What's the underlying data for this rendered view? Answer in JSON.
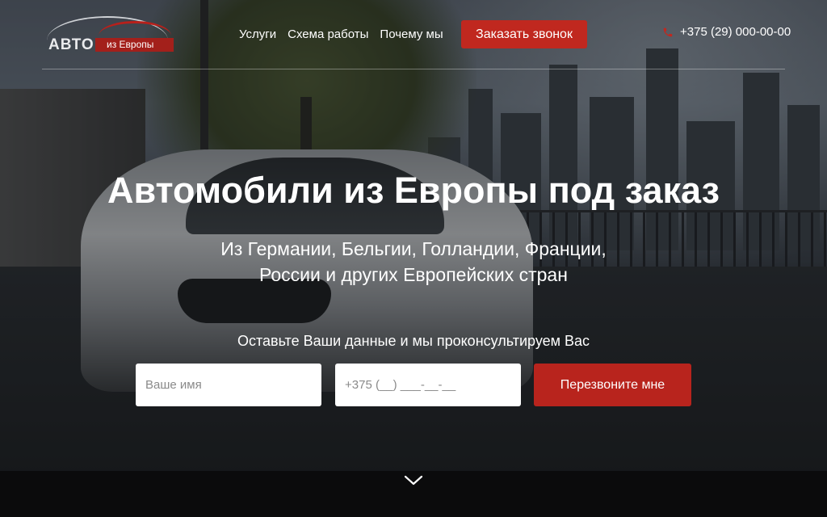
{
  "header": {
    "logo": {
      "word": "АВТО",
      "sub": "из Европы"
    },
    "nav": [
      {
        "label": "Услуги"
      },
      {
        "label": "Схема работы"
      },
      {
        "label": "Почему мы"
      }
    ],
    "call_button": "Заказать звонок",
    "phone": "+375 (29) 000-00-00",
    "phone_icon": "phone-icon"
  },
  "hero": {
    "title": "Автомобили из Европы под заказ",
    "subtitle_line1": "Из Германии, Бельгии, Голландии, Франции,",
    "subtitle_line2": "России и других Европейских стран",
    "form_caption": "Оставьте Ваши данные и мы проконсультируем Вас",
    "name_placeholder": "Ваше имя",
    "phone_placeholder": "+375 (__) ___-__-__",
    "submit_label": "Перезвоните мне",
    "scroll_icon": "chevron-down-icon"
  },
  "colors": {
    "accent": "#c0281f",
    "submit": "#b8241d",
    "bottom_bar": "#0b0b0c"
  }
}
